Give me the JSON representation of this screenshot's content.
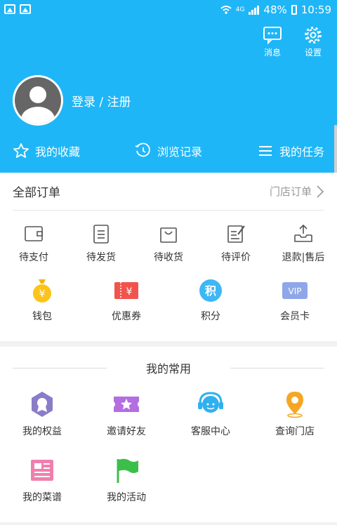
{
  "status_bar": {
    "network": "4G",
    "battery": "48%",
    "time": "10:59"
  },
  "header": {
    "actions": [
      {
        "label": "消息",
        "icon": "message-icon"
      },
      {
        "label": "设置",
        "icon": "gear-icon"
      }
    ],
    "login_label": "登录 / 注册",
    "quick_links": [
      {
        "label": "我的收藏",
        "icon": "star-icon"
      },
      {
        "label": "浏览记录",
        "icon": "history-icon"
      },
      {
        "label": "我的任务",
        "icon": "list-icon"
      }
    ],
    "bg_color": "#1fb6f7"
  },
  "orders": {
    "title": "全部订单",
    "store_orders_label": "门店订单",
    "items": [
      {
        "label": "待支付",
        "icon": "wallet-outline-icon"
      },
      {
        "label": "待发货",
        "icon": "clipboard-icon"
      },
      {
        "label": "待收货",
        "icon": "shopping-bag-icon"
      },
      {
        "label": "待评价",
        "icon": "edit-note-icon"
      },
      {
        "label": "退款|售后",
        "icon": "inbox-upload-icon"
      }
    ]
  },
  "wallet": {
    "items": [
      {
        "label": "钱包",
        "icon": "money-bag-icon",
        "glyph": "¥"
      },
      {
        "label": "优惠券",
        "icon": "coupon-icon",
        "glyph": "¥"
      },
      {
        "label": "积分",
        "icon": "points-icon",
        "glyph": "积"
      },
      {
        "label": "会员卡",
        "icon": "vip-card-icon",
        "glyph": "VIP"
      }
    ]
  },
  "common": {
    "title": "我的常用",
    "items": [
      {
        "label": "我的权益",
        "icon": "badge-icon"
      },
      {
        "label": "邀请好友",
        "icon": "ticket-star-icon"
      },
      {
        "label": "客服中心",
        "icon": "headset-icon"
      },
      {
        "label": "查询门店",
        "icon": "location-pin-icon"
      },
      {
        "label": "我的菜谱",
        "icon": "recipe-icon"
      },
      {
        "label": "我的活动",
        "icon": "flag-icon"
      }
    ]
  }
}
